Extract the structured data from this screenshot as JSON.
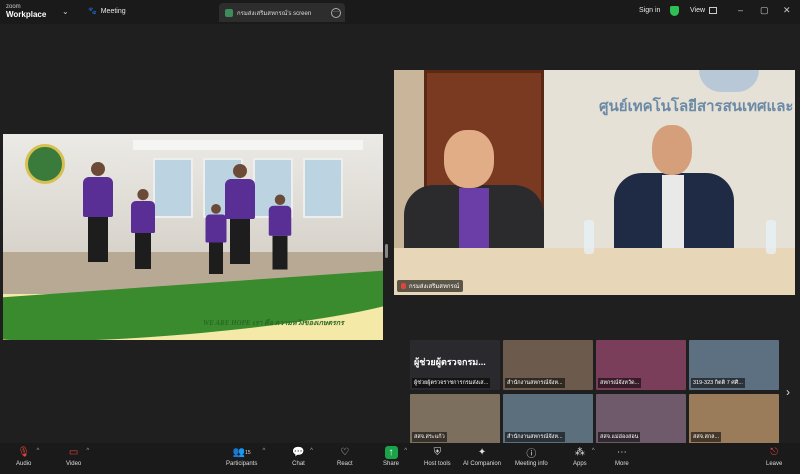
{
  "app": {
    "logo_line1": "zoom",
    "logo_line2": "Workplace",
    "meeting_label": "Meeting"
  },
  "tab": {
    "title": "กรมส่งเสริมสหกรณ์'s screen"
  },
  "header": {
    "signin": "Sign in",
    "view": "View"
  },
  "videos": [
    {
      "banner_text": "WE ARE HOPE เรา คือ ความหวังของเกษตรกร"
    },
    {
      "sign_text": "ศูนย์เทคโนโลยีสารสนเทศและ",
      "name": "กรมส่งเสริมสหกรณ์"
    }
  ],
  "gallery": [
    {
      "title": "ผู้ช่วยผู้ตรวจกรม...",
      "label": "ผู้ช่วยผู้ตรวจราชการกรมส่งเส..."
    },
    {
      "label": "สำนักงานสหกรณ์จังห..."
    },
    {
      "label": "สหกรณ์จังหวัด..."
    },
    {
      "label": "319-323 กิตติ 7 ศศิ..."
    },
    {
      "label": "สสจ.สระแก้ว"
    },
    {
      "label": "สำนักงานสหกรณ์จังห..."
    },
    {
      "label": "สสจ.แม่ฮ่องสอน"
    },
    {
      "label": "สสจ.สกล..."
    }
  ],
  "toolbar": {
    "audio": "Audio",
    "video": "Video",
    "participants": "Participants",
    "participant_count": "15",
    "chat": "Chat",
    "react": "React",
    "share": "Share",
    "host_tools": "Host tools",
    "ai": "AI Companion",
    "info": "Meeting info",
    "apps": "Apps",
    "more": "More",
    "leave": "Leave"
  },
  "colors": {
    "share": "#1aa34a",
    "leave": "#e0453c",
    "shield": "#2fbf55"
  }
}
